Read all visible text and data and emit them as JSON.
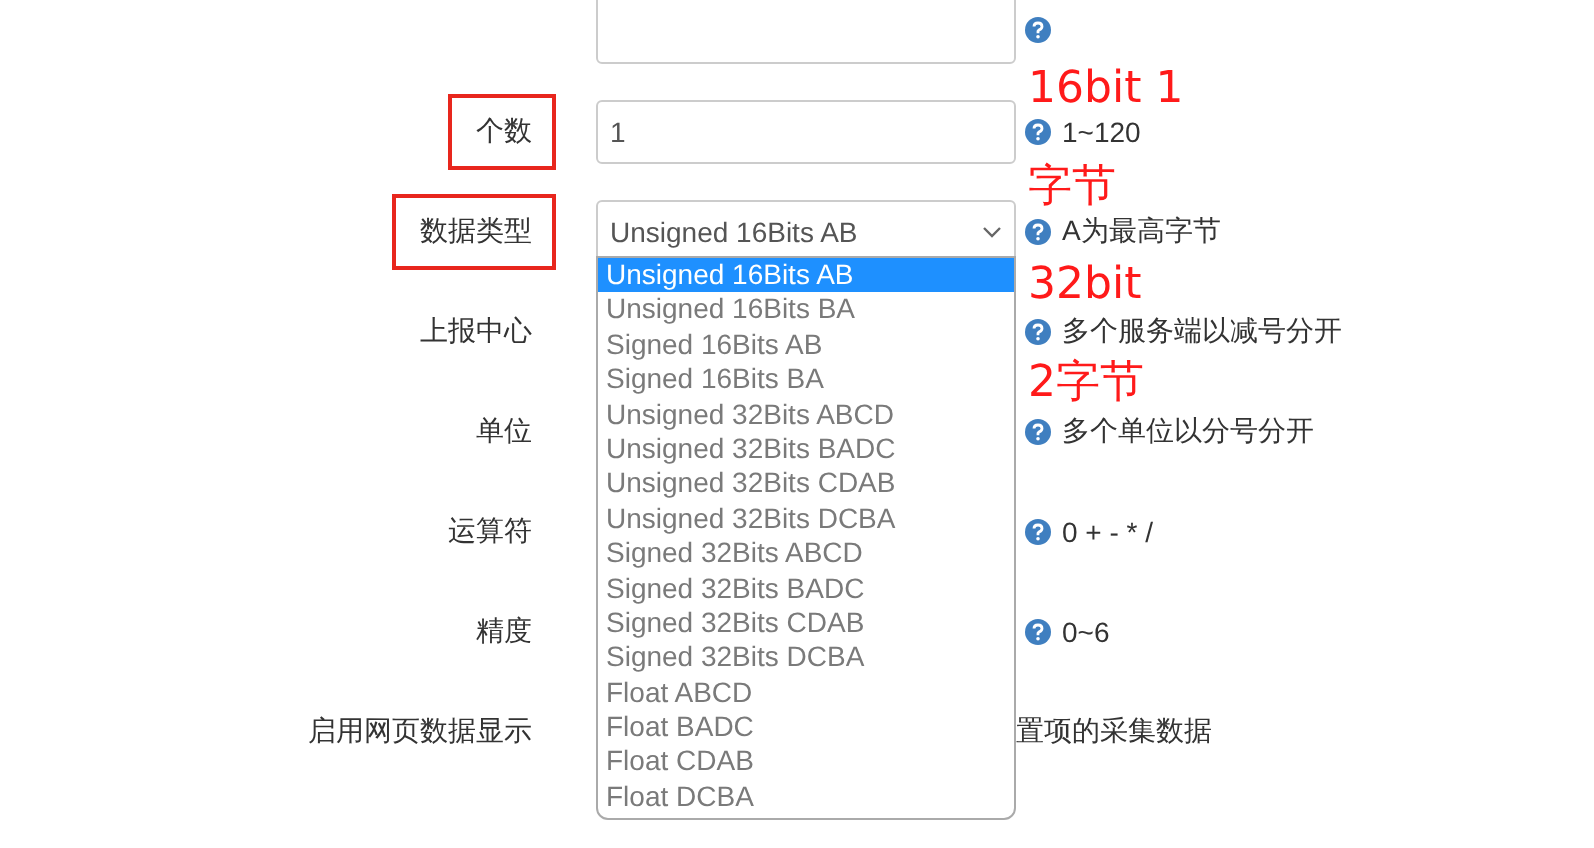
{
  "rows": [
    {
      "kind": "cut_input",
      "help_icon": true
    },
    {
      "kind": "input",
      "label": "个数",
      "highlighted": true,
      "value": "1",
      "help_icon": true,
      "help": "1~120"
    },
    {
      "kind": "select",
      "label": "数据类型",
      "highlighted": true,
      "value": "Unsigned 16Bits AB",
      "help_icon": true,
      "help": "A为最高字节"
    },
    {
      "kind": "covered",
      "label": "上报中心",
      "highlighted": false,
      "help_icon": true,
      "help": "多个服务端以减号分开"
    },
    {
      "kind": "covered",
      "label": "单位",
      "highlighted": false,
      "help_icon": true,
      "help": "多个单位以分号分开"
    },
    {
      "kind": "covered",
      "label": "运算符",
      "highlighted": false,
      "help_icon": true,
      "help": "0 + - * /"
    },
    {
      "kind": "covered",
      "label": "精度",
      "highlighted": false,
      "help_icon": true,
      "help": "0~6"
    },
    {
      "kind": "covered",
      "label": "启用网页数据显示",
      "highlighted": false,
      "help_icon": false,
      "help": "置项的采集数据"
    }
  ],
  "dropdown": {
    "options": [
      {
        "label": "Unsigned 16Bits AB",
        "selected": true
      },
      {
        "label": "Unsigned 16Bits BA",
        "selected": false
      },
      {
        "label": "Signed 16Bits AB",
        "selected": false
      },
      {
        "label": "Signed 16Bits BA",
        "selected": false
      },
      {
        "label": "Unsigned 32Bits ABCD",
        "selected": false
      },
      {
        "label": "Unsigned 32Bits BADC",
        "selected": false
      },
      {
        "label": "Unsigned 32Bits CDAB",
        "selected": false
      },
      {
        "label": "Unsigned 32Bits DCBA",
        "selected": false
      },
      {
        "label": "Signed 32Bits ABCD",
        "selected": false
      },
      {
        "label": "Signed 32Bits BADC",
        "selected": false
      },
      {
        "label": "Signed 32Bits CDAB",
        "selected": false
      },
      {
        "label": "Signed 32Bits DCBA",
        "selected": false
      },
      {
        "label": "Float ABCD",
        "selected": false
      },
      {
        "label": "Float BADC",
        "selected": false
      },
      {
        "label": "Float CDAB",
        "selected": false
      },
      {
        "label": "Float DCBA",
        "selected": false
      }
    ]
  },
  "annotation_lines": [
    "16bit 1",
    "字节",
    "32bit",
    "2字节"
  ]
}
